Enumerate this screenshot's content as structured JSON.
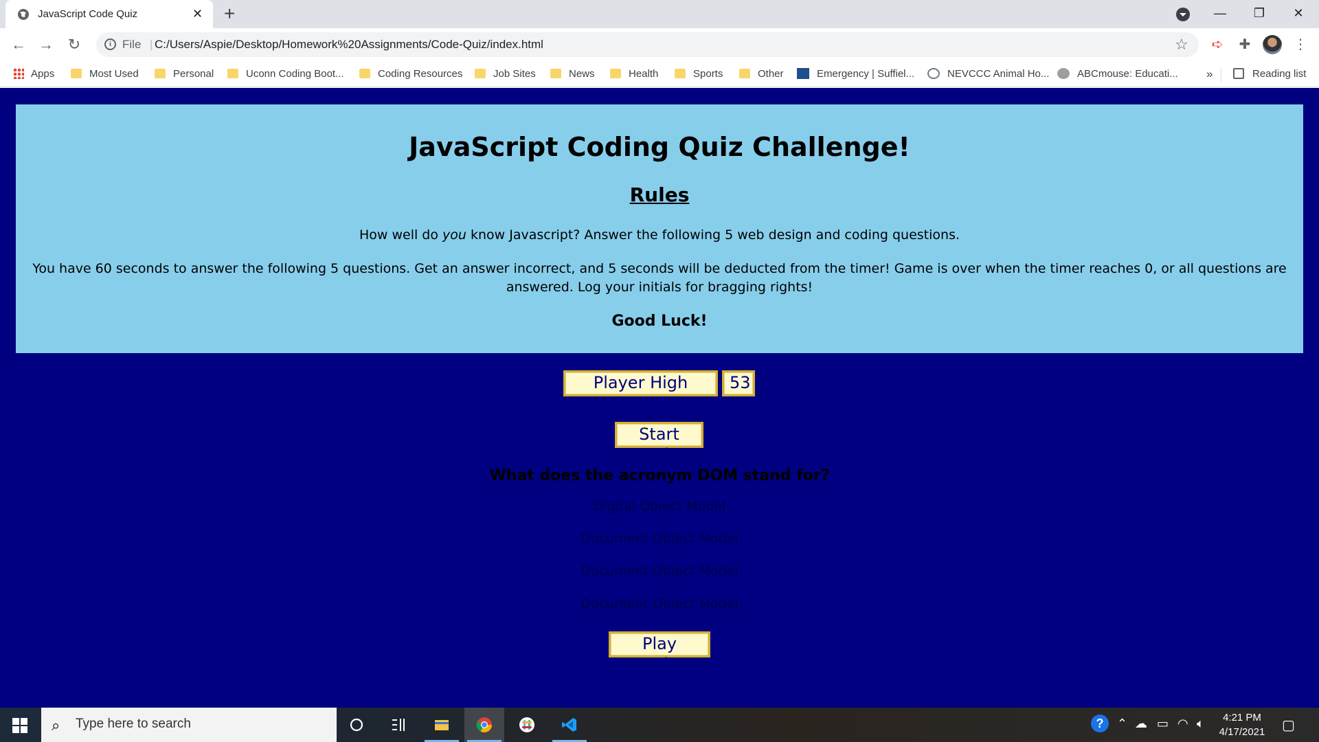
{
  "browser": {
    "tab_title": "JavaScript Code Quiz",
    "tab_close": "✕",
    "new_tab": "+",
    "url_scheme_label": "File",
    "url": "C:/Users/Aspie/Desktop/Homework%20Assignments/Code-Quiz/index.html",
    "bookmarks": [
      {
        "label": "Apps",
        "icon": "apps-grid-icon"
      },
      {
        "label": "Most Used",
        "icon": "folder-icon"
      },
      {
        "label": "Personal",
        "icon": "folder-icon"
      },
      {
        "label": "Uconn Coding Boot...",
        "icon": "folder-icon"
      },
      {
        "label": "Coding Resources",
        "icon": "folder-icon"
      },
      {
        "label": "Job Sites",
        "icon": "folder-icon"
      },
      {
        "label": "News",
        "icon": "folder-icon"
      },
      {
        "label": "Health",
        "icon": "folder-icon"
      },
      {
        "label": "Sports",
        "icon": "folder-icon"
      },
      {
        "label": "Other",
        "icon": "folder-icon"
      },
      {
        "label": "Emergency | Suffiel...",
        "icon": "site-icon"
      },
      {
        "label": "NEVCCC Animal Ho...",
        "icon": "site-icon"
      },
      {
        "label": "ABCmouse: Educati...",
        "icon": "site-icon"
      }
    ],
    "bookmarks_overflow": "»",
    "reading_list": "Reading list"
  },
  "quiz": {
    "title": "JavaScript Coding Quiz Challenge!",
    "rules_heading": "Rules",
    "intro_before": "How well do ",
    "intro_em": "you",
    "intro_after": " know Javascript? Answer the following 5 web design and coding questions.",
    "rules_text": "You have 60 seconds to answer the following 5 questions. Get an answer incorrect, and 5 seconds will be deducted from the timer! Game is over when the timer reaches 0, or all questions are answered. Log your initials for bragging rights!",
    "good_luck": "Good Luck!",
    "high_scores_label": "Player High Scores",
    "timer_value": "53",
    "start_label": "Start Quiz",
    "question": "What does the acronym DOM stand for?",
    "answers": [
      "Digital Object Model",
      "Document Object Model",
      "Document Object Model",
      "Document Object Model"
    ],
    "play_again_label": "Play Again?"
  },
  "taskbar": {
    "search_placeholder": "Type here to search",
    "time": "4:21 PM",
    "date": "4/17/2021"
  },
  "colors": {
    "page_background": "#000080",
    "card_background": "#87ceeb",
    "button_background": "#fffacd",
    "button_border": "#d4af37"
  }
}
